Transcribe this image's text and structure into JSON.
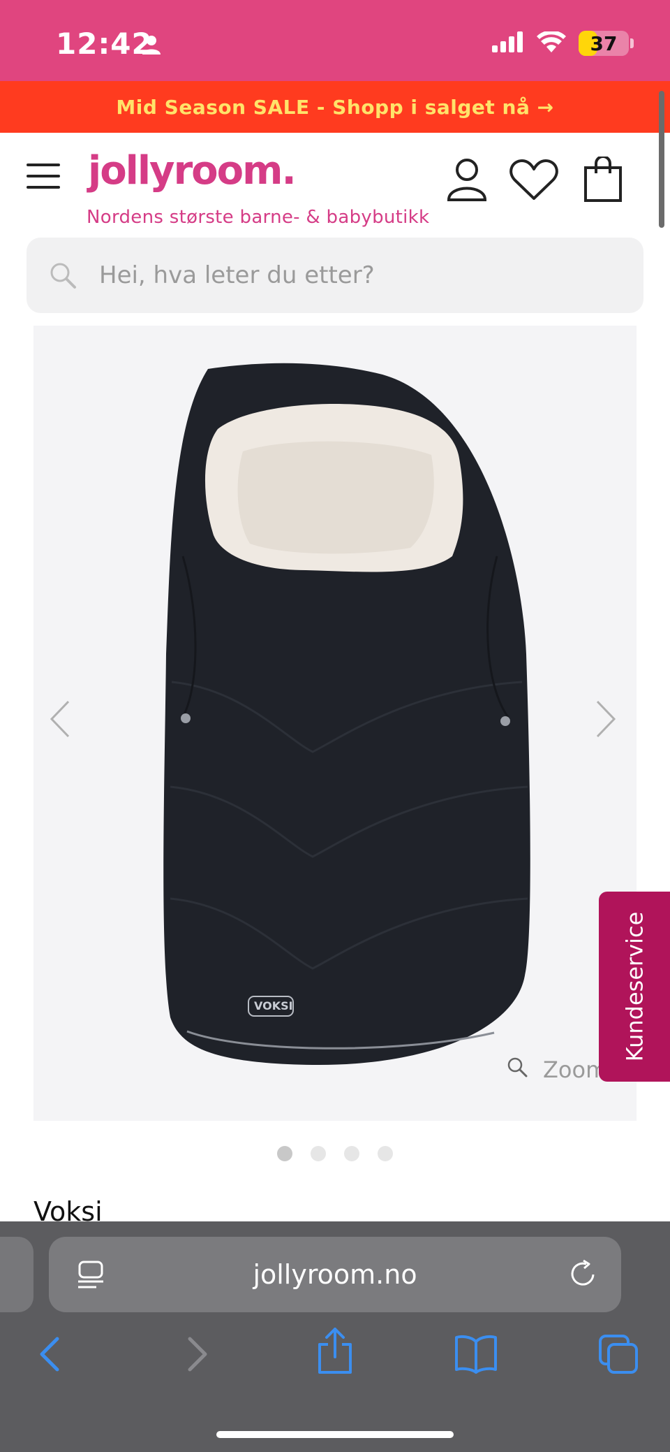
{
  "status": {
    "time": "12:42",
    "battery": "37",
    "battery_level": 0.37
  },
  "promo": {
    "text": "Mid Season SALE - Shopp i salget nå →"
  },
  "header": {
    "logo": "jollyroom.",
    "tagline": "Nordens største barne- & babybutikk"
  },
  "search": {
    "placeholder": "Hei, hva leter du etter?"
  },
  "gallery": {
    "product_brand_mark": "VOKSI",
    "zoom_label": "Zoom",
    "current_image": 1,
    "image_count": 4
  },
  "side_tab": {
    "label": "Kundeservice"
  },
  "product": {
    "brand": "Voksi"
  },
  "browser": {
    "url": "jollyroom.no"
  },
  "colors": {
    "status_bar": "#e0457f",
    "promo_bg": "#ff3b1f",
    "promo_text": "#ffe36a",
    "brand_pink": "#d53c86",
    "kundeservice_bg": "#b0145a",
    "browser_blue": "#3b8ef0"
  }
}
